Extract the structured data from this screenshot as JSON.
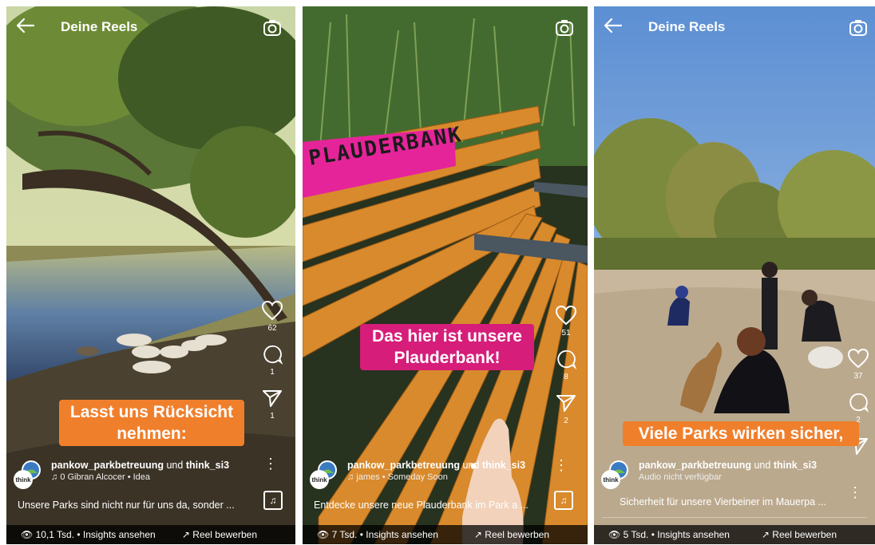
{
  "header": {
    "title": "Deine Reels"
  },
  "reels": [
    {
      "likes": "62",
      "comments": "1",
      "shares": "1",
      "caption_lines": [
        "Lasst uns Rücksicht",
        "nehmen:"
      ],
      "owner": "pankow_parkbetreuung",
      "connector": "und",
      "collab": "think_si3",
      "audio_count": "0",
      "audio": "Gibran Alcocer • Idea",
      "description": "Unsere Parks sind nicht nur für uns da, sonder ...",
      "views": "10,1 Tsd. • Insights ansehen",
      "boost": "Reel bewerben"
    },
    {
      "likes": "51",
      "comments": "8",
      "shares": "2",
      "bench_sign": "PLAUDERBANK",
      "caption_lines": [
        "Das hier ist unsere",
        "Plauderbank!"
      ],
      "owner": "pankow_parkbetreuung",
      "connector": "und",
      "collab": "think_si3",
      "audio": "james • Someday Soon",
      "description": "Entdecke unsere neue Plauderbank im Park a ...",
      "views": "7 Tsd. • Insights ansehen",
      "boost": "Reel bewerben"
    },
    {
      "likes": "37",
      "comments": "2",
      "caption_lines": [
        "Viele Parks wirken sicher,"
      ],
      "owner": "pankow_parkbetreuung",
      "connector": "und",
      "collab": "think_si3",
      "audio": "Audio nicht verfügbar",
      "description": "Sicherheit für unsere Vierbeiner im Mauerpa ...",
      "views": "5 Tsd. • Insights ansehen",
      "boost": "Reel bewerben"
    }
  ],
  "colors": {
    "caption_orange": "#f07f2c",
    "caption_pink": "#d61d7a"
  },
  "icons": [
    "back-arrow-icon",
    "camera-icon",
    "heart-icon",
    "comment-icon",
    "share-icon",
    "more-icon",
    "music-icon",
    "eye-icon",
    "trend-icon"
  ]
}
